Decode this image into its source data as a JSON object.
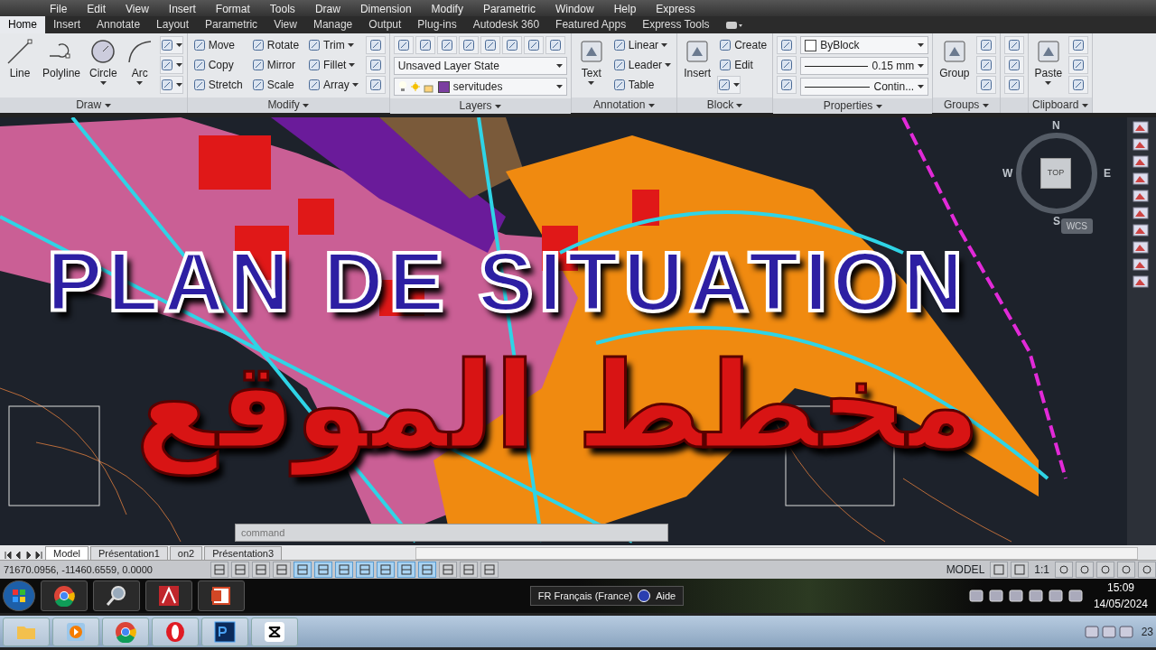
{
  "menu_bar": [
    "File",
    "Edit",
    "View",
    "Insert",
    "Format",
    "Tools",
    "Draw",
    "Dimension",
    "Modify",
    "Parametric",
    "Window",
    "Help",
    "Express"
  ],
  "ribbon_tabs": [
    {
      "label": "Home",
      "selected": true
    },
    {
      "label": "Insert",
      "selected": false
    },
    {
      "label": "Annotate",
      "selected": false
    },
    {
      "label": "Layout",
      "selected": false
    },
    {
      "label": "Parametric",
      "selected": false
    },
    {
      "label": "View",
      "selected": false
    },
    {
      "label": "Manage",
      "selected": false
    },
    {
      "label": "Output",
      "selected": false
    },
    {
      "label": "Plug-ins",
      "selected": false
    },
    {
      "label": "Autodesk 360",
      "selected": false
    },
    {
      "label": "Featured Apps",
      "selected": false
    },
    {
      "label": "Express Tools",
      "selected": false
    }
  ],
  "ribbon_panels": [
    {
      "title": "Draw",
      "tools": [
        {
          "kind": "large",
          "label": "Line",
          "menu": false
        },
        {
          "kind": "large",
          "label": "Polyline",
          "menu": false
        },
        {
          "kind": "large",
          "label": "Circle",
          "menu": true
        },
        {
          "kind": "large",
          "label": "Arc",
          "menu": true
        },
        {
          "kind": "icon",
          "menu": true
        },
        {
          "kind": "icon",
          "menu": true
        },
        {
          "kind": "icon",
          "menu": true
        }
      ]
    },
    {
      "title": "Modify",
      "tools": [
        {
          "kind": "small",
          "label": "Move",
          "menu": false
        },
        {
          "kind": "small",
          "label": "Copy",
          "menu": false
        },
        {
          "kind": "small",
          "label": "Stretch",
          "menu": false
        },
        {
          "kind": "small",
          "label": "Rotate",
          "menu": false
        },
        {
          "kind": "small",
          "label": "Mirror",
          "menu": false
        },
        {
          "kind": "small",
          "label": "Scale",
          "menu": false
        },
        {
          "kind": "small",
          "label": "Trim",
          "menu": true
        },
        {
          "kind": "small",
          "label": "Fillet",
          "menu": true
        },
        {
          "kind": "small",
          "label": "Array",
          "menu": true
        },
        {
          "kind": "icon",
          "menu": false
        },
        {
          "kind": "icon",
          "menu": false
        },
        {
          "kind": "icon",
          "menu": false
        }
      ]
    },
    {
      "title": "Layers",
      "tools": [
        {
          "kind": "toolbar",
          "items": [
            {
              "menu": false
            },
            {
              "menu": false
            },
            {
              "menu": false
            },
            {
              "menu": false
            },
            {
              "menu": false
            },
            {
              "menu": false
            },
            {
              "menu": false
            },
            {
              "menu": false
            }
          ]
        },
        {
          "kind": "dropdown",
          "value": "Unsaved Layer State"
        },
        {
          "kind": "layer",
          "value": "servitudes",
          "color": "#7b3fa0"
        }
      ]
    },
    {
      "title": "Annotation",
      "tools": [
        {
          "kind": "large",
          "label": "Text",
          "menu": true
        },
        {
          "kind": "small",
          "label": "Linear",
          "menu": true
        },
        {
          "kind": "small",
          "label": "Leader",
          "menu": true
        },
        {
          "kind": "small",
          "label": "Table",
          "menu": false
        }
      ]
    },
    {
      "title": "Block",
      "tools": [
        {
          "kind": "large",
          "label": "Insert",
          "menu": false
        },
        {
          "kind": "small",
          "label": "Create",
          "menu": false
        },
        {
          "kind": "small",
          "label": "Edit",
          "menu": false
        },
        {
          "kind": "icon",
          "menu": true
        }
      ]
    },
    {
      "title": "Properties",
      "tools": [
        {
          "kind": "icon",
          "menu": false
        },
        {
          "kind": "icon",
          "menu": false
        },
        {
          "kind": "icon",
          "menu": false
        },
        {
          "kind": "dropdown",
          "value": "ByBlock",
          "color": "#ffffff"
        },
        {
          "kind": "dropdown",
          "value": "0.15 mm",
          "line_sample": true
        },
        {
          "kind": "dropdown",
          "value": "Contin...",
          "line_sample": true
        }
      ]
    },
    {
      "title": "Groups",
      "tools": [
        {
          "kind": "large",
          "label": "Group",
          "menu": false
        },
        {
          "kind": "icon",
          "menu": false
        },
        {
          "kind": "icon",
          "menu": false
        },
        {
          "kind": "icon",
          "menu": false
        }
      ]
    },
    {
      "tools": [
        {
          "kind": "icon",
          "menu": false
        },
        {
          "kind": "icon",
          "menu": false
        },
        {
          "kind": "icon",
          "menu": false
        }
      ]
    },
    {
      "title": "Clipboard",
      "tools": [
        {
          "kind": "large",
          "label": "Paste",
          "menu": true
        },
        {
          "kind": "icon",
          "menu": false
        },
        {
          "kind": "icon",
          "menu": false
        },
        {
          "kind": "icon",
          "menu": false
        }
      ]
    }
  ],
  "viewcube": {
    "north": "N",
    "west": "W",
    "east": "E",
    "south": "S",
    "face": "TOP",
    "ucs": "WCS"
  },
  "overlay": {
    "title": "PLAN DE SITUATION",
    "arabic_title": "مخطط الموقع"
  },
  "command_line": {
    "placeholder": "command"
  },
  "layout_tabs": [
    {
      "label": "Model",
      "selected": true
    },
    {
      "label": "Présentation1",
      "selected": false
    },
    {
      "label": "on2",
      "selected": false
    },
    {
      "label": "Présentation3",
      "selected": false
    }
  ],
  "status_bar": {
    "coordinates": "71670.0956, -11460.6559, 0.0000",
    "toggles": [
      {
        "on": false
      },
      {
        "on": false
      },
      {
        "on": false
      },
      {
        "on": false
      },
      {
        "on": true
      },
      {
        "on": true
      },
      {
        "on": true
      },
      {
        "on": true
      },
      {
        "on": true
      },
      {
        "on": true
      },
      {
        "on": true
      },
      {
        "on": false
      },
      {
        "on": false
      },
      {
        "on": false
      }
    ],
    "space": "MODEL",
    "scale": "1:1"
  },
  "taskbar": {
    "language": "FR Français (France)",
    "help": "Aide",
    "time": "15:09",
    "date": "14/05/2024"
  },
  "second_taskbar": {
    "clock_fragment": "23"
  }
}
